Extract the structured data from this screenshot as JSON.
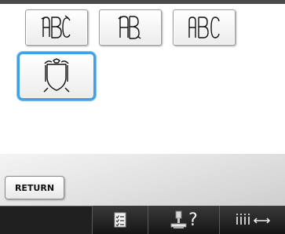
{
  "styles": [
    {
      "name": "monogram-style-1"
    },
    {
      "name": "monogram-style-2"
    },
    {
      "name": "monogram-style-3"
    },
    {
      "name": "frame-shield-style",
      "selected": true
    }
  ],
  "return_button": {
    "label": "RETURN"
  },
  "toolbar": {
    "icons": [
      "checklist-icon",
      "machine-help-icon",
      "thread-tension-icon"
    ],
    "help_mark": "?"
  },
  "colors": {
    "selection": "#3fa0e6"
  }
}
